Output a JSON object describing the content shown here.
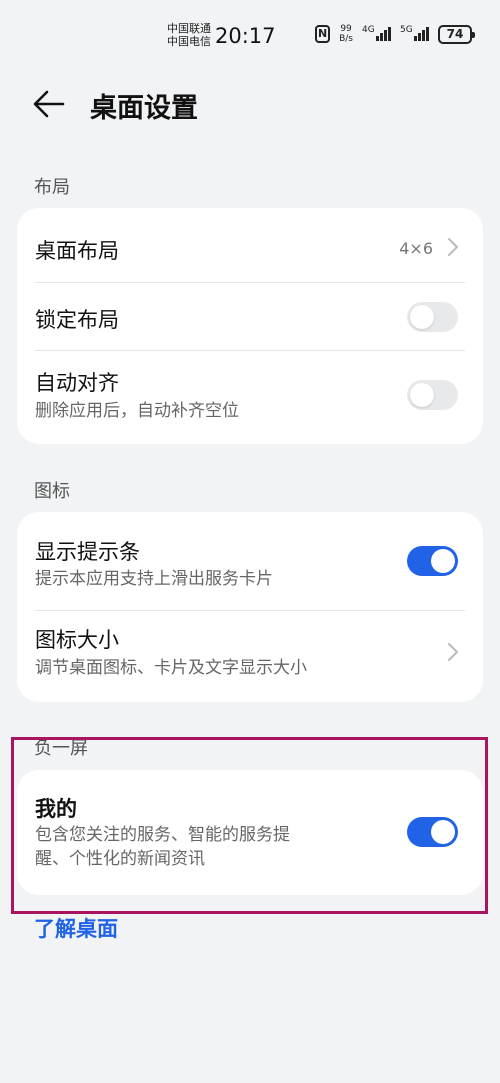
{
  "status_bar": {
    "carrier_1": "中国联通",
    "carrier_2": "中国电信",
    "time": "20:17",
    "nfc": "N",
    "net_speed_value": "99",
    "net_speed_unit": "B/s",
    "signal_1_tag": "4G",
    "signal_2_tag": "5G",
    "battery": "74"
  },
  "header": {
    "title": "桌面设置",
    "back_icon": "back-arrow-icon"
  },
  "sections": {
    "layout": {
      "label": "布局",
      "desktop_layout": {
        "title": "桌面布局",
        "value": "4×6"
      },
      "lock_layout": {
        "title": "锁定布局",
        "toggle": "off"
      },
      "auto_align": {
        "title": "自动对齐",
        "subtitle": "删除应用后，自动补齐空位",
        "toggle": "off"
      }
    },
    "icons": {
      "label": "图标",
      "show_hint_bar": {
        "title": "显示提示条",
        "subtitle": "提示本应用支持上滑出服务卡片",
        "toggle": "on"
      },
      "icon_size": {
        "title": "图标大小",
        "subtitle": "调节桌面图标、卡片及文字显示大小"
      }
    },
    "minus_one_screen": {
      "label": "负一屏",
      "mine": {
        "title": "我的",
        "subtitle_line1": "包含您关注的服务、智能的服务提",
        "subtitle_line2": "醒、个性化的新闻资讯",
        "toggle": "on"
      }
    }
  },
  "learn_link": "了解桌面",
  "colors": {
    "background": "#f1f3f5",
    "accent": "#2063e6",
    "highlight_border": "#a8145f"
  }
}
